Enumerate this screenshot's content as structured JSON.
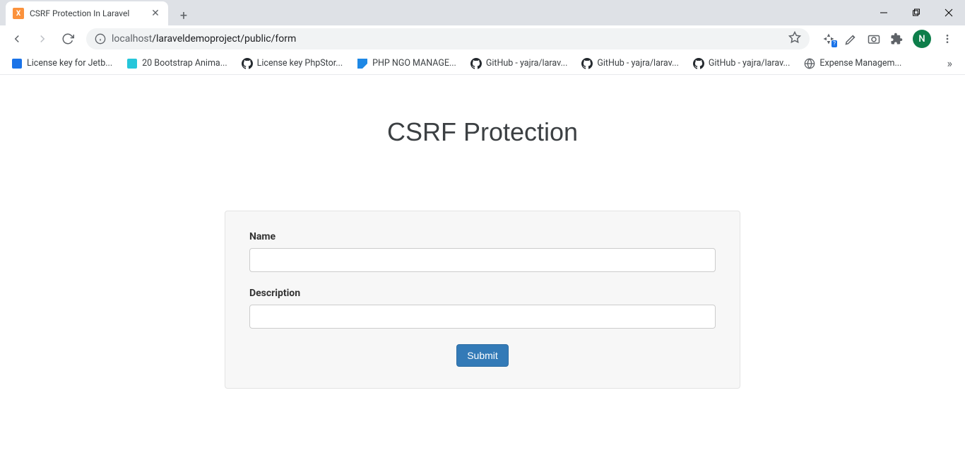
{
  "browser": {
    "tab": {
      "title": "CSRF Protection In Laravel",
      "favicon_letter": "X"
    },
    "url_host": "localhost",
    "url_path": "/laraveldemoproject/public/form",
    "avatar_letter": "N",
    "translate_badge": "?"
  },
  "bookmarks": [
    {
      "label": "License key for Jetb...",
      "icon": "blue-square"
    },
    {
      "label": "20 Bootstrap Anima...",
      "icon": "teal-arrow"
    },
    {
      "label": "License key PhpStor...",
      "icon": "github"
    },
    {
      "label": "PHP NGO MANAGE...",
      "icon": "blue-diamond"
    },
    {
      "label": "GitHub - yajra/larav...",
      "icon": "github"
    },
    {
      "label": "GitHub - yajra/larav...",
      "icon": "github"
    },
    {
      "label": "GitHub - yajra/larav...",
      "icon": "github"
    },
    {
      "label": "Expense Managem...",
      "icon": "globe"
    }
  ],
  "page": {
    "heading": "CSRF Protection",
    "form": {
      "name_label": "Name",
      "name_value": "",
      "desc_label": "Description",
      "desc_value": "",
      "submit_label": "Submit"
    }
  }
}
